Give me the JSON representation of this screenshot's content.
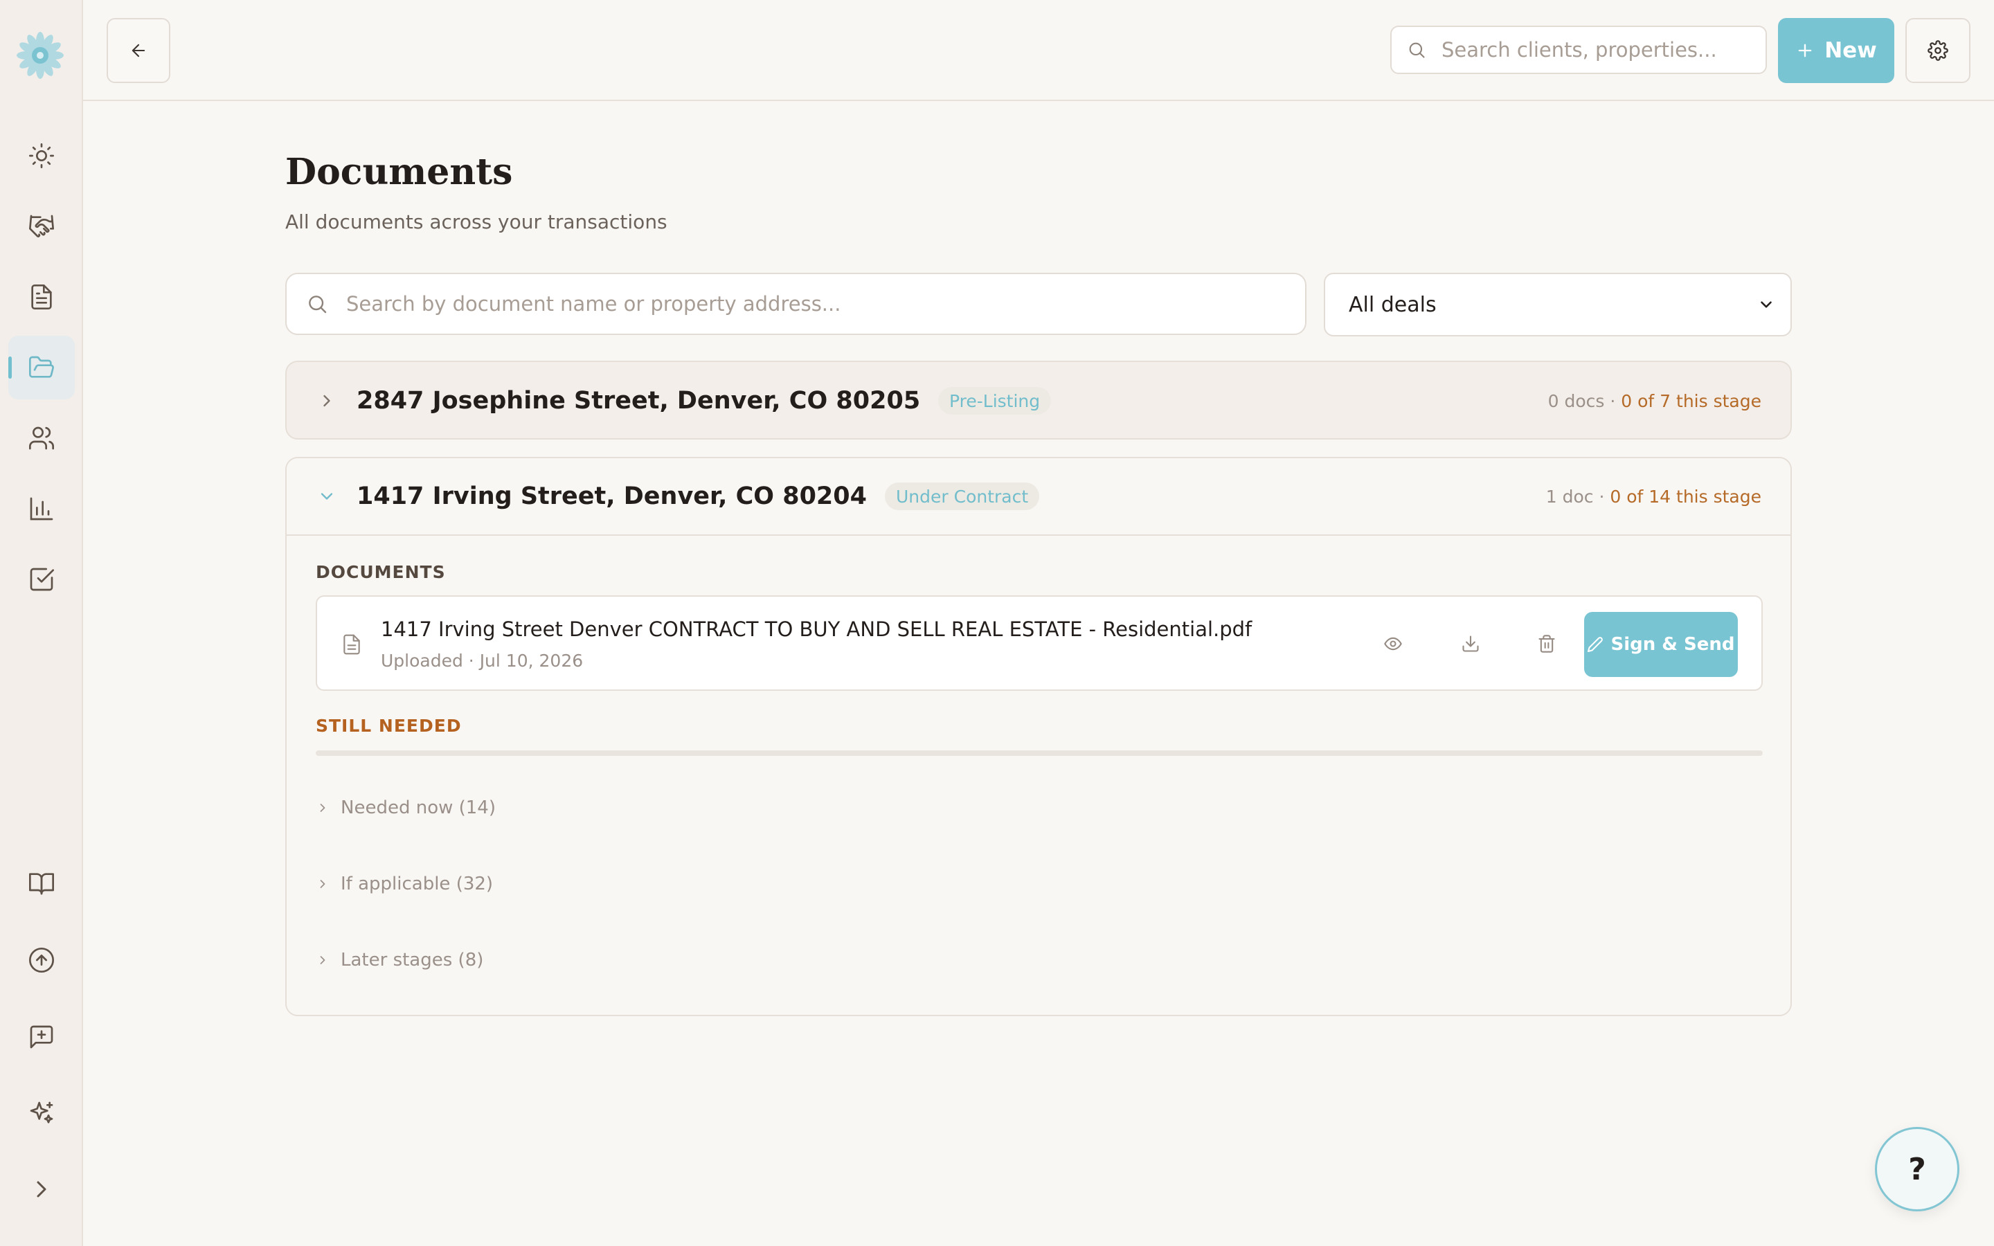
{
  "sidebar": {
    "items": [
      {
        "name": "sun-icon",
        "active": false
      },
      {
        "name": "handshake-icon",
        "active": false
      },
      {
        "name": "document-icon",
        "active": false
      },
      {
        "name": "folder-open-icon",
        "active": true
      },
      {
        "name": "users-icon",
        "active": false
      },
      {
        "name": "bar-chart-icon",
        "active": false
      },
      {
        "name": "checkbox-icon",
        "active": false
      },
      {
        "name": "book-open-icon",
        "active": false
      },
      {
        "name": "upload-circle-icon",
        "active": false
      },
      {
        "name": "message-plus-icon",
        "active": false
      },
      {
        "name": "sparkles-icon",
        "active": false
      },
      {
        "name": "chevron-right-icon",
        "active": false
      }
    ]
  },
  "topbar": {
    "search_placeholder": "Search clients, properties...",
    "new_label": "New"
  },
  "page": {
    "title": "Documents",
    "subtitle": "All documents across your transactions"
  },
  "filters": {
    "search_placeholder": "Search by document name or property address...",
    "deal_filter_value": "All deals"
  },
  "deals": [
    {
      "address": "2847 Josephine Street, Denver, CO 80205",
      "stage": "Pre-Listing",
      "docs_count": "0 docs",
      "stage_progress": "0 of 7 this stage",
      "expanded": false
    },
    {
      "address": "1417 Irving Street, Denver, CO 80204",
      "stage": "Under Contract",
      "docs_count": "1 doc",
      "stage_progress": "0 of 14 this stage",
      "expanded": true,
      "documents_label": "DOCUMENTS",
      "documents": [
        {
          "name": "1417 Irving Street Denver CONTRACT TO BUY AND SELL REAL ESTATE - Residential.pdf",
          "meta": "Uploaded · Jul 10, 2026",
          "sign_label": "Sign & Send"
        }
      ],
      "still_needed_label": "STILL NEEDED",
      "still_needed_progress": 0,
      "requirement_groups": [
        {
          "label": "Needed now (14)"
        },
        {
          "label": "If applicable (32)"
        },
        {
          "label": "Later stages (8)"
        }
      ]
    }
  ],
  "help": {
    "label": "?"
  },
  "colors": {
    "accent": "#79c4d2",
    "stage_text": "#b56a28",
    "still_needed": "#b56120",
    "background": "#f9f7f4",
    "sidebar": "#f3eee9"
  }
}
